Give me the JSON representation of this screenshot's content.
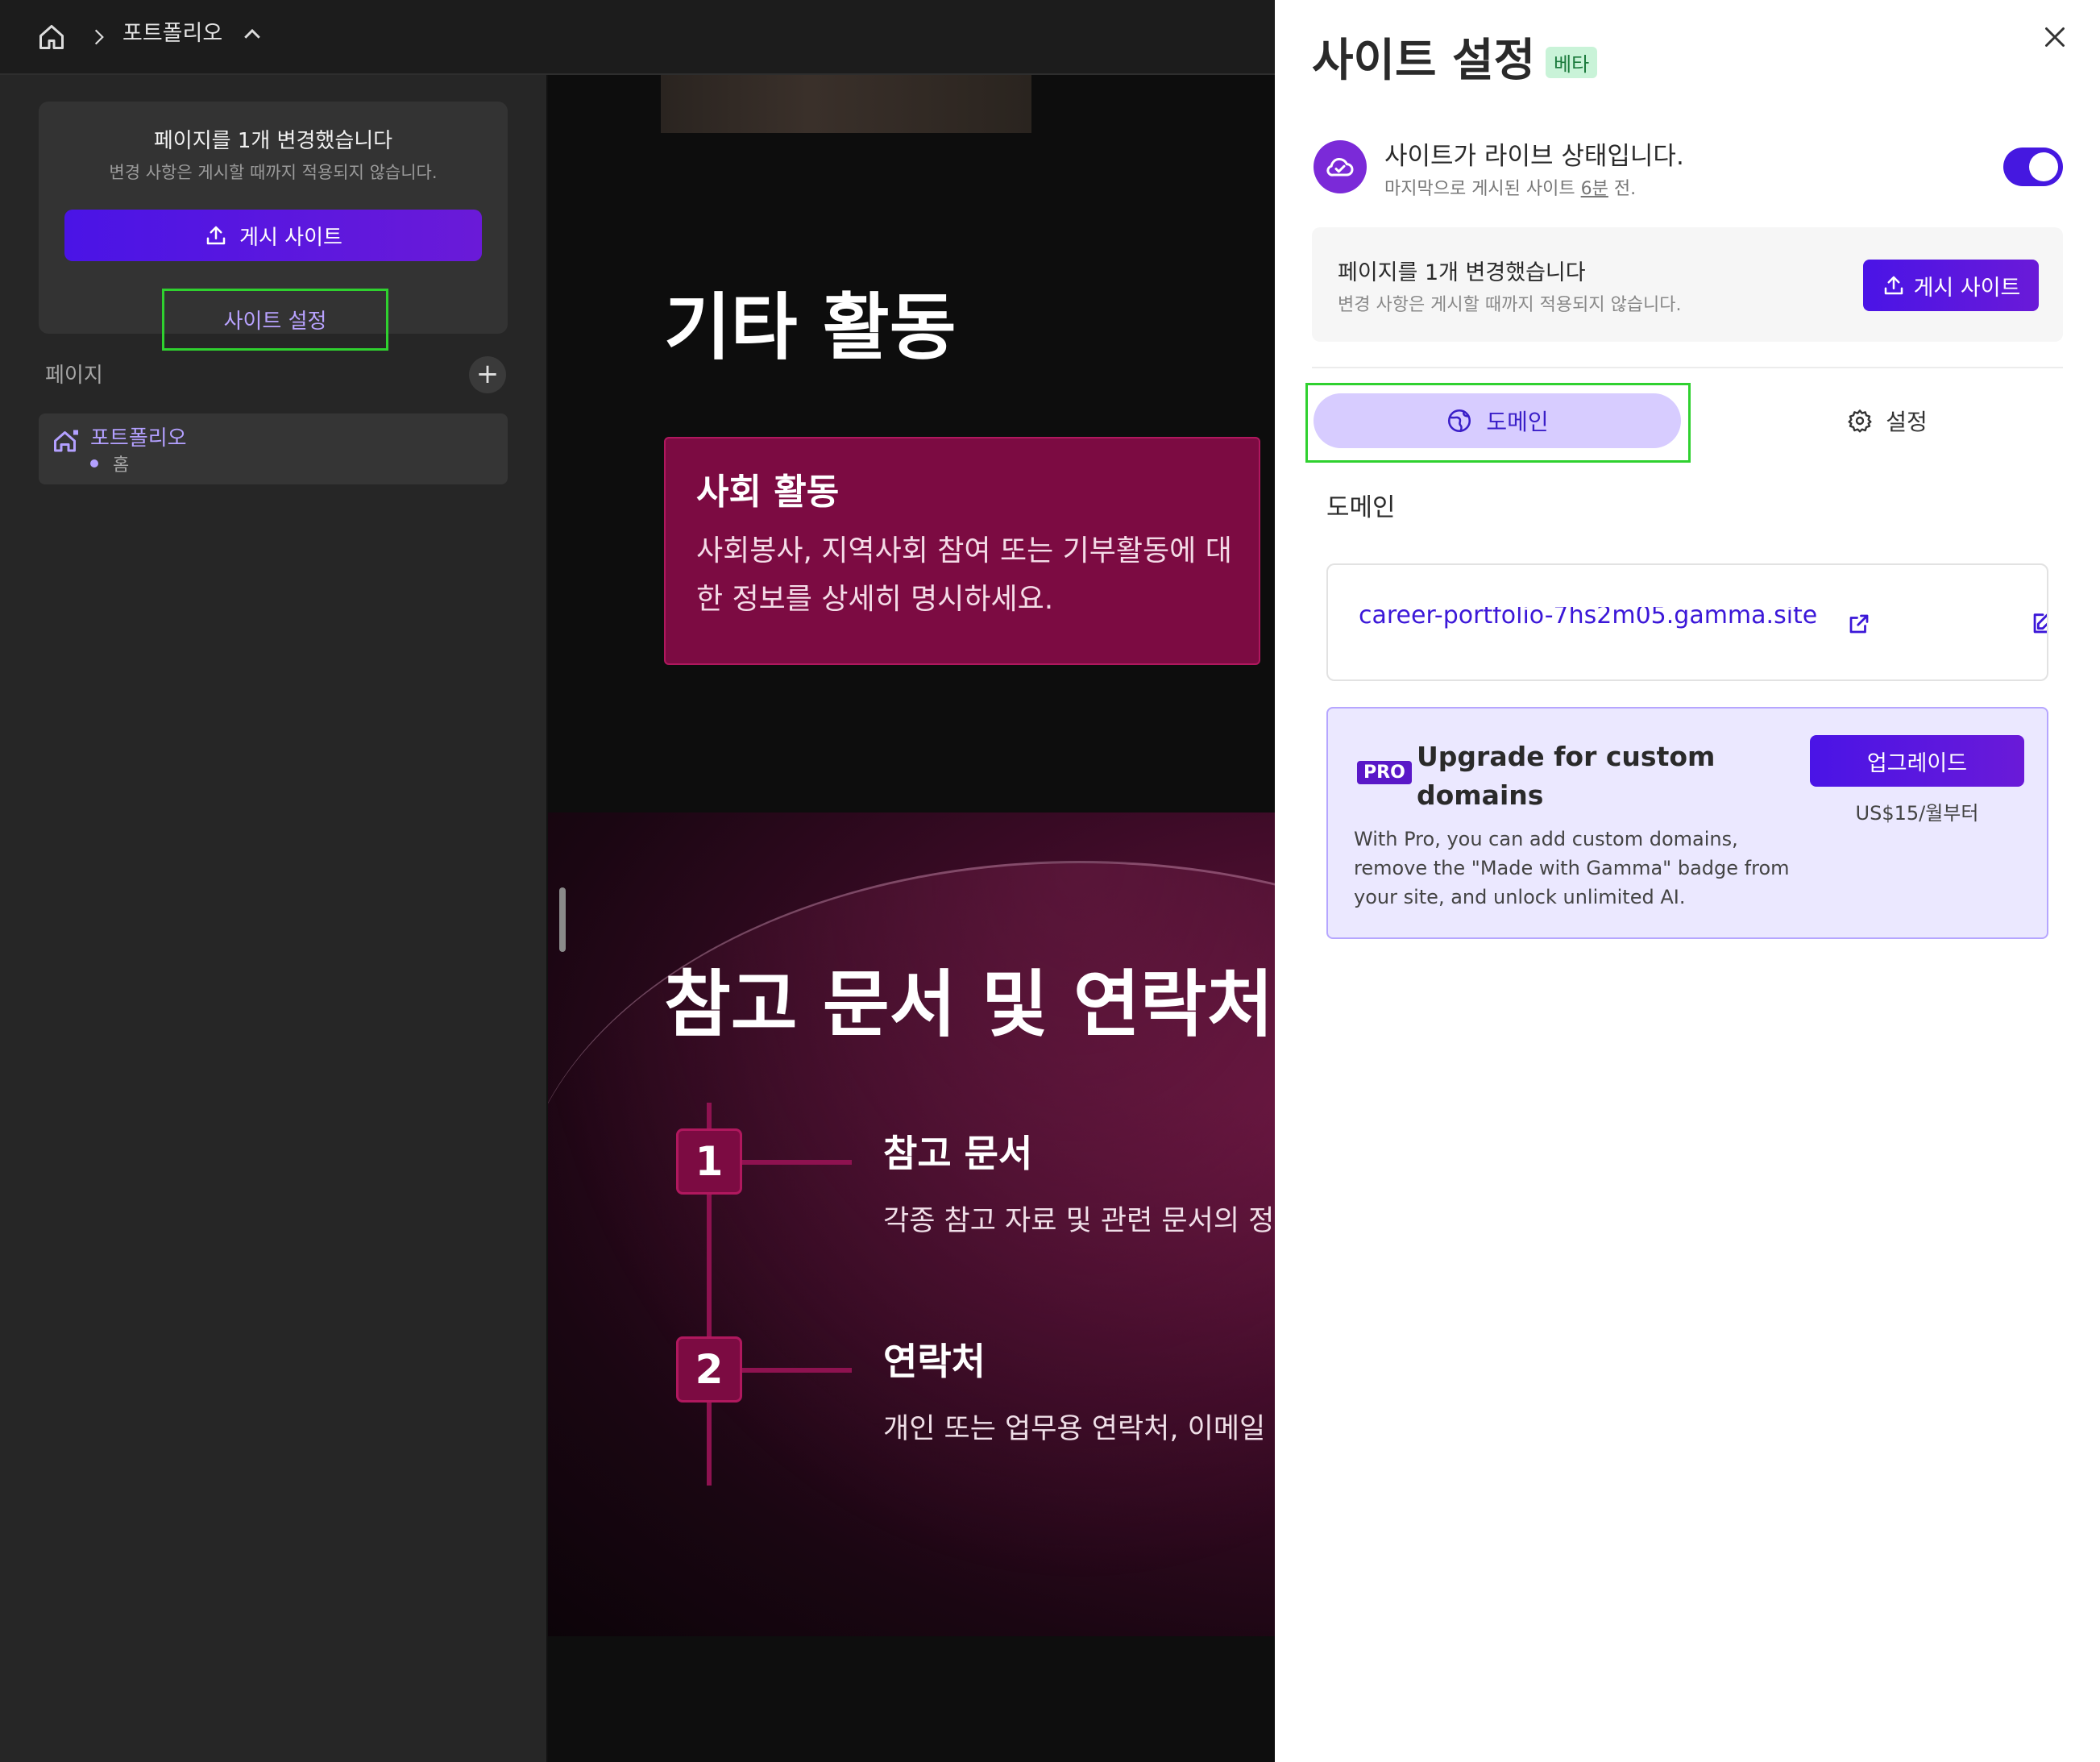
{
  "topbar": {
    "breadcrumb_title": "포트폴리오"
  },
  "sidebar": {
    "publish_card": {
      "title": "페이지를 1개 변경했습니다",
      "subtitle": "변경 사항은 게시할 때까지 적용되지 않습니다.",
      "publish_button": "게시 사이트",
      "settings_link": "사이트 설정"
    },
    "pages_label": "페이지",
    "add_page": "+",
    "page": {
      "name": "포트폴리오",
      "sub": "홈"
    }
  },
  "preview": {
    "heading_other": "기타 활동",
    "card_title": "사회 활동",
    "card_body": "사회봉사, 지역사회 참여 또는 기부활동에 대한 정보를 상세히 명시하세요.",
    "heading_ref": "참고 문서 및 연락처",
    "items": [
      {
        "num": "1",
        "title": "참고 문서",
        "body": "각종 참고 자료 및 관련 문서의 정보"
      },
      {
        "num": "2",
        "title": "연락처",
        "body": "개인 또는 업무용 연락처, 이메일 주소"
      }
    ]
  },
  "panel": {
    "title": "사이트 설정",
    "beta": "베타",
    "live_title": "사이트가 라이브 상태입니다.",
    "live_sub_prefix": "마지막으로 게시된 사이트 ",
    "live_sub_time": "6분",
    "live_sub_suffix": " 전.",
    "toggle_on": true,
    "pub_title": "페이지를 1개 변경했습니다",
    "pub_sub": "변경 사항은 게시할 때까지 적용되지 않습니다.",
    "pub_button": "게시 사이트",
    "tab_domain": "도메인",
    "tab_settings": "설정",
    "domain_label": "도메인",
    "domain_url": "career-portfolio-7hs2m05.gamma.site",
    "upgrade": {
      "badge": "PRO",
      "title": "Upgrade for custom domains",
      "body": "With Pro, you can add custom domains, remove the \"Made with Gamma\" badge from your site, and unlock unlimited AI.",
      "button": "업그레이드",
      "price": "US$15/월부터"
    }
  },
  "colors": {
    "accent": "#4a14e6",
    "card": "#7c0b42",
    "highlight": "#2fd12f"
  }
}
